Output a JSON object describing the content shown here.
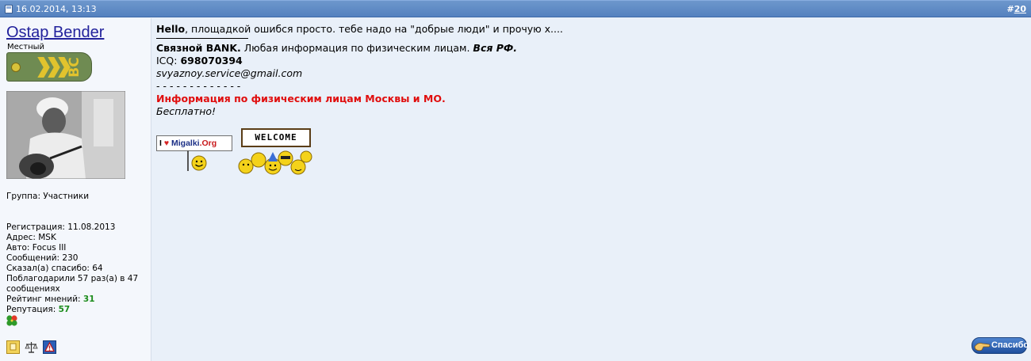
{
  "header": {
    "date": "16.02.2014, 13:13",
    "post_number_prefix": "#",
    "post_number": "20"
  },
  "user": {
    "name": "Ostap Bender",
    "title": "Местный",
    "rank_letters": "ВС",
    "group": "Группа: Участники",
    "info": [
      "Регистрация: 11.08.2013",
      "Адрес: MSK",
      "Авто: Focus III",
      "Сообщений: 230",
      "Сказал(а) спасибо: 64",
      "Поблагодарили 57 раз(а) в 47 сообщениях"
    ],
    "rating_label": "Рейтинг мнений: ",
    "rating_value": "31",
    "reputation_label": "Репутация: ",
    "reputation_value": "57"
  },
  "post": {
    "greeting_bold": "Hello",
    "greeting_rest": ", площадкой ошибся просто. тебе надо на \"добрые люди\" и прочую х....",
    "sig_company": "Связной BANK.",
    "sig_text": " Любая информация по физическим лицам. ",
    "sig_region": "Вся РФ.",
    "icq_label": "ICQ: ",
    "icq_number": "698070394",
    "email": "svyaznoy.service@gmail.com",
    "dashes": "- - - - - - - - - - - - -",
    "red_line": "Информация по физическим лицам Москвы и МО.",
    "free": "Бесплатно!",
    "banner1_i": "I",
    "banner1_site": "Migalki",
    "banner1_tld": ".Org",
    "banner2_text": "WELCOME"
  },
  "actions": {
    "thanks_label": "Спасибо"
  },
  "colors": {
    "header_blue": "#5481bf",
    "username_blue": "#22229c",
    "green_values": "#1c8c1c",
    "red_text": "#e00d0d"
  }
}
